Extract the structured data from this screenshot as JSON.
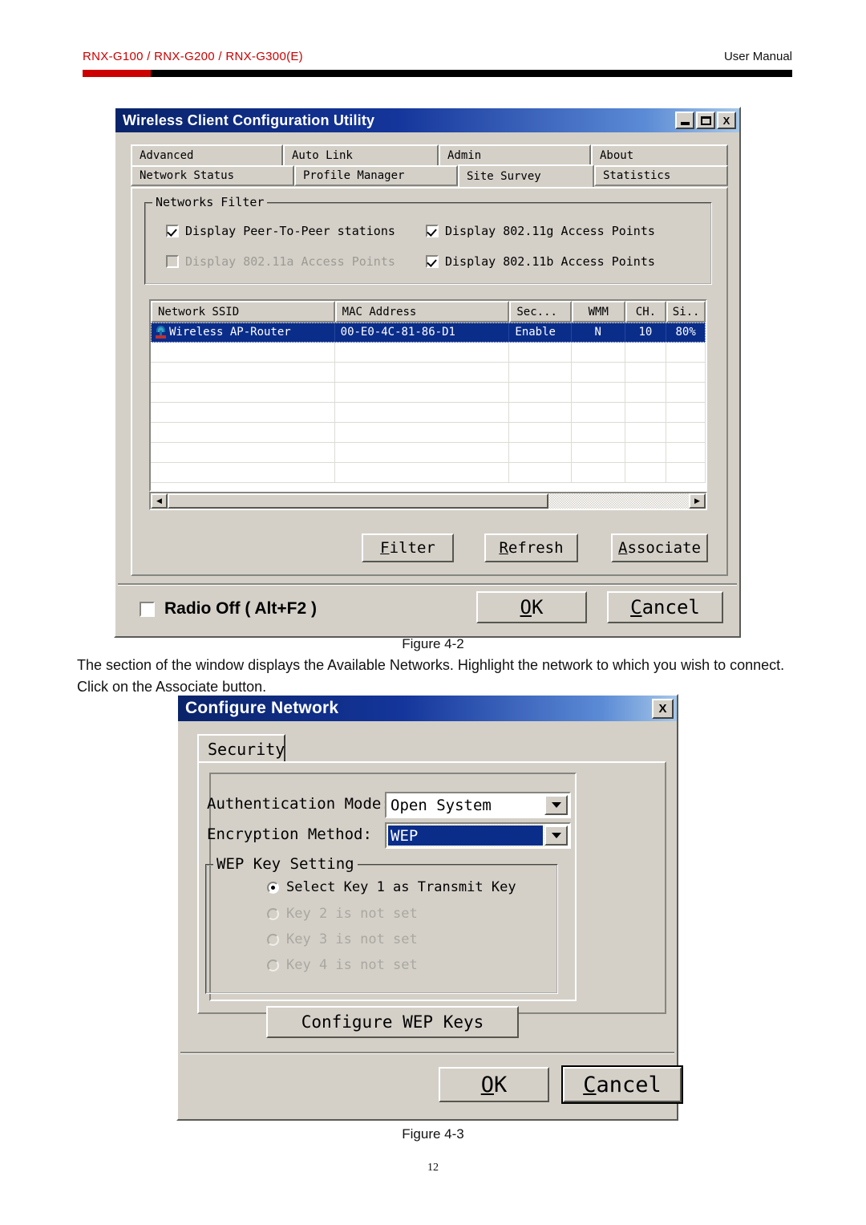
{
  "page": {
    "header_left": "RNX-G100 / RNX-G200 / RNX-G300(E)",
    "header_right": "User Manual",
    "page_number": "12",
    "body_text": "The section of the window displays the Available Networks. Highlight the network to which you wish to connect. Click on the Associate button.",
    "figure_2_caption": "Figure 4-2",
    "figure_3_caption": "Figure 4-3",
    "accent_red": "#cc0000",
    "titlebar_blue": "#0a246a",
    "selection_blue": "#0a2d8a",
    "face_gray": "#d4d0c8"
  },
  "utility_window": {
    "title": "Wireless Client Configuration Utility",
    "window_controls": {
      "minimize": "minimize-icon",
      "maximize": "maximize-icon",
      "close": "X"
    },
    "tabs_row1": [
      {
        "label": "Advanced",
        "active": false
      },
      {
        "label": "Auto Link",
        "active": false
      },
      {
        "label": "Admin",
        "active": false
      },
      {
        "label": "About",
        "active": false
      }
    ],
    "tabs_row2": [
      {
        "label": "Network Status",
        "active": false
      },
      {
        "label": "Profile Manager",
        "active": false
      },
      {
        "label": "Site Survey",
        "active": true
      },
      {
        "label": "Statistics",
        "active": false
      }
    ],
    "networks_filter": {
      "legend": "Networks Filter",
      "options": [
        {
          "label": "Display Peer-To-Peer stations",
          "checked": true,
          "disabled": false
        },
        {
          "label": "Display 802.11g Access Points",
          "checked": true,
          "disabled": false
        },
        {
          "label": "Display 802.11a Access Points",
          "checked": false,
          "disabled": true
        },
        {
          "label": "Display 802.11b Access Points",
          "checked": true,
          "disabled": false
        }
      ]
    },
    "network_table": {
      "columns": [
        "Network SSID",
        "MAC Address",
        "Sec...",
        "WMM",
        "CH.",
        "Si.."
      ],
      "rows": [
        {
          "icon": "access-point-icon",
          "ssid": "Wireless AP-Router",
          "mac": "00-E0-4C-81-86-D1",
          "security": "Enable",
          "wmm": "N",
          "channel": "10",
          "signal": "80%",
          "selected": true
        }
      ],
      "empty_row_count": 7,
      "scrollbar": {
        "left_arrow": "◀",
        "right_arrow": "▶"
      }
    },
    "action_buttons": [
      {
        "label": "Filter",
        "accel": "F"
      },
      {
        "label": "Refresh",
        "accel": "R"
      },
      {
        "label": "Associate",
        "accel": "A"
      }
    ],
    "radio_off": {
      "label": "Radio Off  ( Alt+F2 )",
      "checked": false
    },
    "footer_buttons": [
      {
        "label": "OK",
        "accel": "O",
        "focus": false
      },
      {
        "label": "Cancel",
        "accel": "C",
        "focus": false
      }
    ]
  },
  "configure_dialog": {
    "title": "Configure Network",
    "close_label": "X",
    "tabs": [
      {
        "label": "Security",
        "active": true
      }
    ],
    "fields": [
      {
        "label": "Authentication Mode:",
        "value": "Open System",
        "focused": false
      },
      {
        "label": "Encryption Method:",
        "value": "WEP",
        "focused": true
      }
    ],
    "wep_group": {
      "legend": "WEP Key Setting",
      "keys": [
        {
          "label": "Select Key 1 as Transmit Key",
          "selected": true,
          "disabled": false
        },
        {
          "label": "Key 2 is not set",
          "selected": false,
          "disabled": true
        },
        {
          "label": "Key 3 is not set",
          "selected": false,
          "disabled": true
        },
        {
          "label": "Key 4 is not set",
          "selected": false,
          "disabled": true
        }
      ],
      "configure_button": "Configure WEP Keys"
    },
    "footer_buttons": [
      {
        "label": "OK",
        "accel": "O",
        "focus": false
      },
      {
        "label": "Cancel",
        "accel": "C",
        "focus": true
      }
    ]
  }
}
